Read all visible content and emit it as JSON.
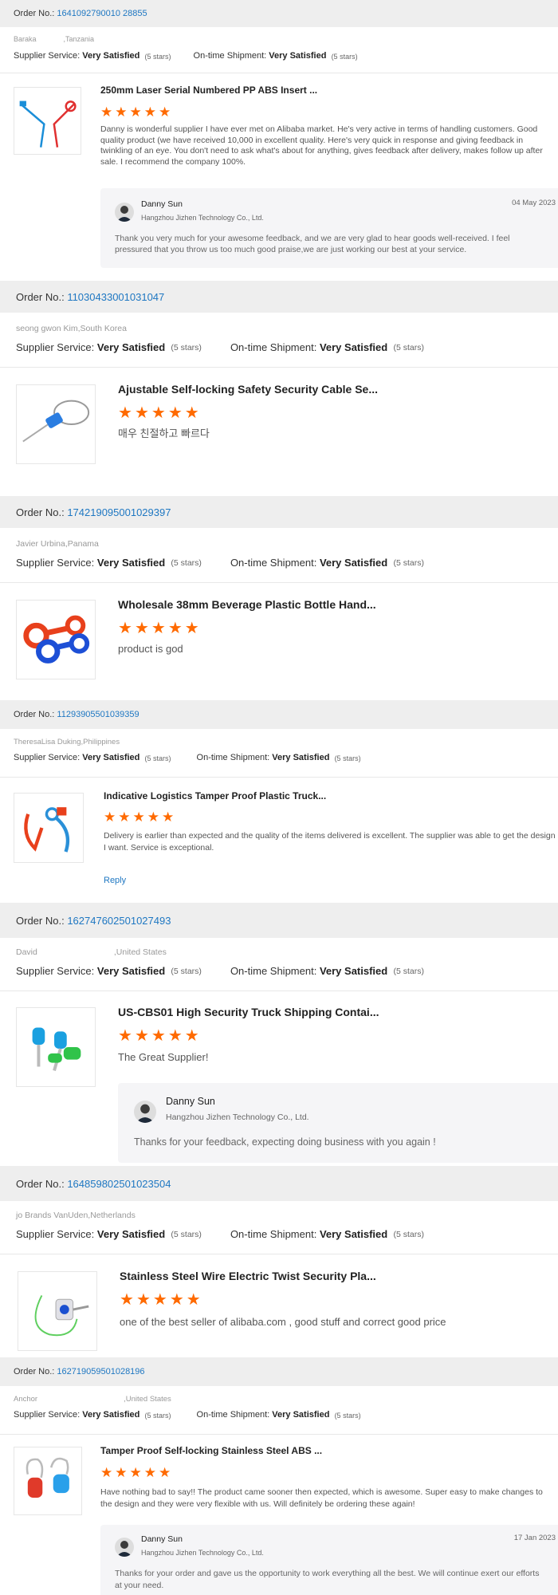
{
  "reviews": [
    {
      "order_label": "Order No.:",
      "order_number": "1641092790010 28855",
      "buyer_name": "Baraka",
      "buyer_country": ",Tanzania",
      "supplier_label": "Supplier Service:",
      "supplier_value": "Very Satisfied",
      "supplier_stars": "(5 stars)",
      "shipment_label": "On-time Shipment:",
      "shipment_value": "Very Satisfied",
      "shipment_stars": "(5 stars)",
      "product_title": "250mm Laser Serial Numbered PP ABS Insert ...",
      "rating": 5,
      "review_text": "Danny is wonderful supplier I have ever met on Alibaba market. He's very active in terms of handling customers. Good quality product (we have received 10,000 in excellent quality. Here's very quick in response and giving feedback in twinkling of an eye. You don't need to ask what's about for anything, gives feedback after delivery, makes follow up after sale. I recommend the company 100%.",
      "reply": {
        "name": "Danny Sun",
        "company": "Hangzhou Jizhen Technology Co., Ltd.",
        "date": "04 May 2023",
        "text": "Thank you very much for your awesome feedback, and we are very glad to hear goods well-received. I feel pressured that you throw us too much good praise,we are just working our best at your service."
      },
      "image": "blue-red-tag-seals"
    },
    {
      "order_label": "Order No.:",
      "order_number": "11030433001031047",
      "buyer_name": "seong gwon Kim",
      "buyer_country": ",South Korea",
      "supplier_label": "Supplier Service:",
      "supplier_value": "Very Satisfied",
      "supplier_stars": "(5 stars)",
      "shipment_label": "On-time Shipment:",
      "shipment_value": "Very Satisfied",
      "shipment_stars": "(5 stars)",
      "product_title": "Ajustable Self-locking Safety Security Cable Se...",
      "rating": 5,
      "review_text": "매우 친절하고 빠르다",
      "image": "cable-seal"
    },
    {
      "order_label": "Order No.:",
      "order_number": "174219095001029397",
      "buyer_name": "Javier Urbina",
      "buyer_country": ",Panama",
      "supplier_label": "Supplier Service:",
      "supplier_value": "Very Satisfied",
      "supplier_stars": "(5 stars)",
      "shipment_label": "On-time Shipment:",
      "shipment_value": "Very Satisfied",
      "shipment_stars": "(5 stars)",
      "product_title": "Wholesale 38mm Beverage Plastic Bottle Hand...",
      "rating": 5,
      "review_text": "product is god",
      "image": "bottle-handles"
    },
    {
      "order_label": "Order No.:",
      "order_number": "11293905501039359",
      "buyer_name": "TheresaLisa Duking",
      "buyer_country": ",Philippines",
      "supplier_label": "Supplier Service:",
      "supplier_value": "Very Satisfied",
      "supplier_stars": "(5 stars)",
      "shipment_label": "On-time Shipment:",
      "shipment_value": "Very Satisfied",
      "shipment_stars": "(5 stars)",
      "product_title": "Indicative Logistics Tamper Proof Plastic Truck...",
      "rating": 5,
      "review_text": "Delivery is earlier than expected and the quality of the items delivered is excellent. The supplier was able to get the design I want. Service is exceptional.",
      "reply_link": "Reply",
      "image": "plastic-truck-seals"
    },
    {
      "order_label": "Order No.:",
      "order_number": "162747602501027493",
      "buyer_name": "David",
      "buyer_country": ",United States",
      "supplier_label": "Supplier Service:",
      "supplier_value": "Very Satisfied",
      "supplier_stars": "(5 stars)",
      "shipment_label": "On-time Shipment:",
      "shipment_value": "Very Satisfied",
      "shipment_stars": "(5 stars)",
      "product_title": "US-CBS01 High Security Truck Shipping Contai...",
      "rating": 5,
      "review_text": "The Great Supplier!",
      "reply": {
        "name": "Danny Sun",
        "company": "Hangzhou Jizhen Technology Co., Ltd.",
        "date": "",
        "text": "Thanks for your feedback, expecting doing business with you again !"
      },
      "image": "bolt-seals"
    },
    {
      "order_label": "Order No.:",
      "order_number": "164859802501023504",
      "buyer_name": "jo Brands VanUden",
      "buyer_country": ",Netherlands",
      "supplier_label": "Supplier Service:",
      "supplier_value": "Very Satisfied",
      "supplier_stars": "(5 stars)",
      "shipment_label": "On-time Shipment:",
      "shipment_value": "Very Satisfied",
      "shipment_stars": "(5 stars)",
      "product_title": "Stainless Steel Wire Electric Twist Security Pla...",
      "rating": 5,
      "review_text": "one of the best seller of alibaba.com , good stuff and correct good price",
      "image": "twist-wire-seal"
    },
    {
      "order_label": "Order No.:",
      "order_number": "162719059501028196",
      "buyer_name": "Anchor",
      "buyer_country": ",United States",
      "supplier_label": "Supplier Service:",
      "supplier_value": "Very Satisfied",
      "supplier_stars": "(5 stars)",
      "shipment_label": "On-time Shipment:",
      "shipment_value": "Very Satisfied",
      "shipment_stars": "(5 stars)",
      "product_title": "Tamper Proof Self-locking Stainless Steel ABS ...",
      "rating": 5,
      "review_text": "Have nothing bad to say!! The product came sooner then expected, which is awesome. Super easy to make changes to the design and they were very flexible with us. Will definitely be ordering these again!",
      "reply": {
        "name": "Danny Sun",
        "company": "Hangzhou Jizhen Technology Co., Ltd.",
        "date": "17 Jan 2023",
        "text": "Thanks for your order and gave us the opportunity to work everything all the best. We will continue exert our efforts at your need."
      },
      "image": "padlock-seals"
    }
  ],
  "colors": {
    "star": "#ff6a00",
    "order_number": "#1e77c2",
    "order_bar": "#eeeeee",
    "reply_bg": "#f5f5f7"
  }
}
